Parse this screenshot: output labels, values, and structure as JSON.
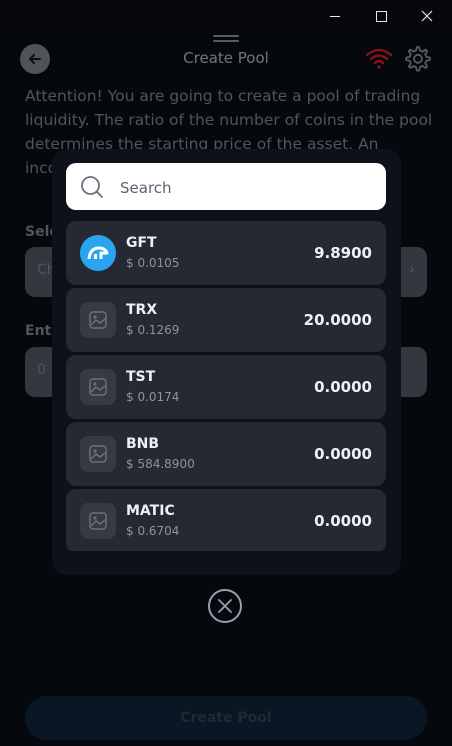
{
  "header": {
    "title": "Create Pool"
  },
  "attention_text": "Attention! You are going to create a pool of trading liquidity. The ratio of the number of coins in the pool determines the starting price of the asset. An incorrect balance may result in losses.",
  "labels": {
    "select": "Select",
    "enter": "Enter"
  },
  "fields": {
    "select_value": "Ch",
    "enter_value": "0"
  },
  "create_button": "Create Pool",
  "search": {
    "placeholder": "Search"
  },
  "tokens": [
    {
      "symbol": "GFT",
      "price": "$ 0.0105",
      "balance": "9.8900",
      "icon": "gft-logo-icon"
    },
    {
      "symbol": "TRX",
      "price": "$ 0.1269",
      "balance": "20.0000",
      "icon": "image-placeholder-icon"
    },
    {
      "symbol": "TST",
      "price": "$ 0.0174",
      "balance": "0.0000",
      "icon": "image-placeholder-icon"
    },
    {
      "symbol": "BNB",
      "price": "$ 584.8900",
      "balance": "0.0000",
      "icon": "image-placeholder-icon"
    },
    {
      "symbol": "MATIC",
      "price": "$ 0.6704",
      "balance": "0.0000",
      "icon": "image-placeholder-icon"
    }
  ],
  "colors": {
    "accent": "#2aa3f0",
    "wifi_warning": "#e0242a"
  }
}
